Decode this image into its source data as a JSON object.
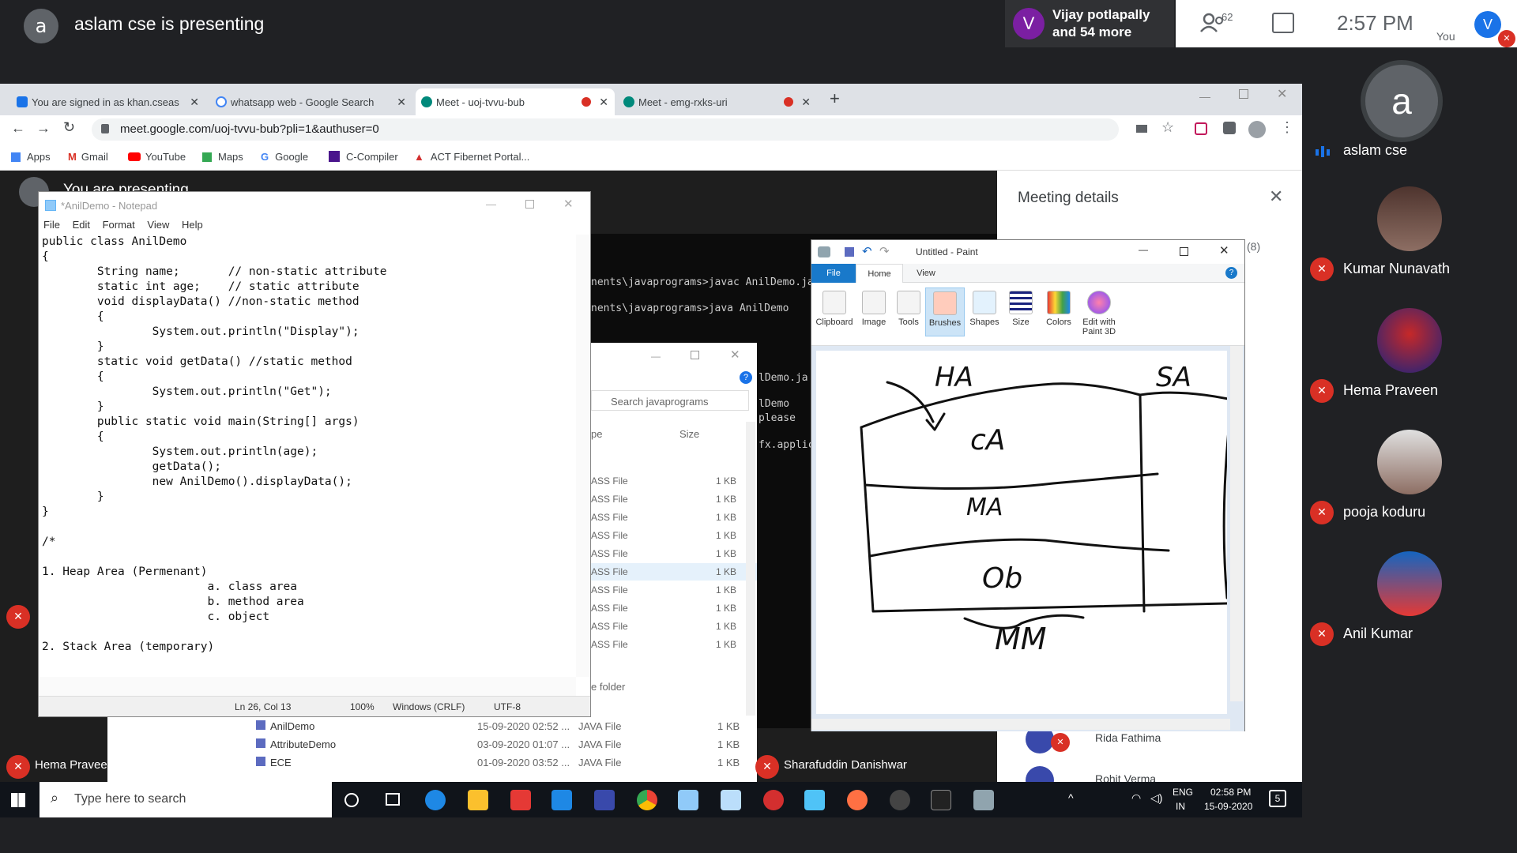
{
  "meet": {
    "presenter_avatar_letter": "a",
    "presenter_text": "aslam cse is presenting",
    "others_avatar_letter": "V",
    "others_line1": "Vijay potlapally",
    "others_line2": "and 54 more",
    "participant_count": "62",
    "time": "2:57 PM",
    "you_avatar_letter": "V",
    "you_label": "You",
    "participants": [
      {
        "name": "aslam cse",
        "avatar": "a"
      },
      {
        "name": "Kumar Nunavath"
      },
      {
        "name": "Hema Praveen"
      },
      {
        "name": "pooja koduru"
      },
      {
        "name": "Anil Kumar"
      }
    ],
    "left_tile_name": "Hema Pravee",
    "center_tile_name": "Sharafuddin Danishwar",
    "meeting_details_title": "Meeting details",
    "meeting_details_count": "(8)",
    "chat_name1": "Rida Fathima",
    "chat_name2": "Rohit Verma",
    "you_are_presenting": "You are presenting"
  },
  "browser": {
    "tabs": [
      {
        "label": "You are signed in as khan.cseas",
        "color": "#1a73e8",
        "fav": "S"
      },
      {
        "label": "whatsapp web - Google Search",
        "color": "#4285f4",
        "fav": "G"
      },
      {
        "label": "Meet - uoj-tvvu-bub",
        "color": "#00897b",
        "fav": ""
      },
      {
        "label": "Meet - emg-rxks-uri",
        "color": "#00897b",
        "fav": ""
      }
    ],
    "url": "meet.google.com/uoj-tvvu-bub?pli=1&authuser=0",
    "bookmarks": [
      "Apps",
      "Gmail",
      "YouTube",
      "Maps",
      "Google",
      "C-Compiler",
      "ACT Fibernet Portal..."
    ]
  },
  "notepad": {
    "title": "*AnilDemo - Notepad",
    "menu": [
      "File",
      "Edit",
      "Format",
      "View",
      "Help"
    ],
    "content": "public class AnilDemo\n{\n        String name;       // non-static attribute\n        static int age;    // static attribute\n        void displayData() //non-static method\n        {\n                System.out.println(\"Display\");\n        }\n        static void getData() //static method\n        {\n                System.out.println(\"Get\");\n        }\n        public static void main(String[] args)\n        {\n                System.out.println(age);\n                getData();\n                new AnilDemo().displayData();\n        }\n}\n\n/*\n\n1. Heap Area (Permenant)\n                        a. class area\n                        b. method area\n                        c. object\n\n2. Stack Area (temporary)",
    "status": {
      "pos": "Ln 26, Col 13",
      "zoom": "100%",
      "eol": "Windows (CRLF)",
      "enc": "UTF-8"
    }
  },
  "cmd": {
    "lines": [
      "nents\\javaprograms>javac AnilDemo.ja",
      "nents\\javaprograms>java AnilDemo",
      "lDemo.ja",
      "lDemo",
      " please ",
      "fx.applic"
    ]
  },
  "explorer": {
    "search_placeholder": "Search javaprograms",
    "col_type": "pe",
    "col_size": "Size",
    "rows": [
      "ASS File",
      "ASS File",
      "ASS File",
      "ASS File",
      "ASS File",
      "ASS File",
      "ASS File",
      "ASS File",
      "ASS File",
      "ASS File"
    ],
    "row_size": "1 KB",
    "folder_label": "e folder",
    "files": [
      {
        "name": "AnilDemo",
        "date": "15-09-2020 02:52 ...",
        "type": "JAVA File",
        "size": "1 KB"
      },
      {
        "name": "AttributeDemo",
        "date": "03-09-2020 01:07 ...",
        "type": "JAVA File",
        "size": "1 KB"
      },
      {
        "name": "ECE",
        "date": "01-09-2020 03:52 ...",
        "type": "JAVA File",
        "size": "1 KB"
      }
    ]
  },
  "paint": {
    "title": "Untitled - Paint",
    "tabs": [
      "File",
      "Home",
      "View"
    ],
    "tools": [
      "Clipboard",
      "Image",
      "Tools",
      "Brushes",
      "Shapes",
      "Size",
      "Colors",
      "Edit with\nPaint 3D"
    ],
    "drawing_labels": [
      "HA",
      "SA",
      "cA",
      "MA",
      "Ob",
      "MM"
    ]
  },
  "taskbar": {
    "search_placeholder": "Type here to search",
    "lang1": "ENG",
    "lang2": "IN",
    "time": "02:58 PM",
    "date": "15-09-2020",
    "notif_count": "5"
  }
}
